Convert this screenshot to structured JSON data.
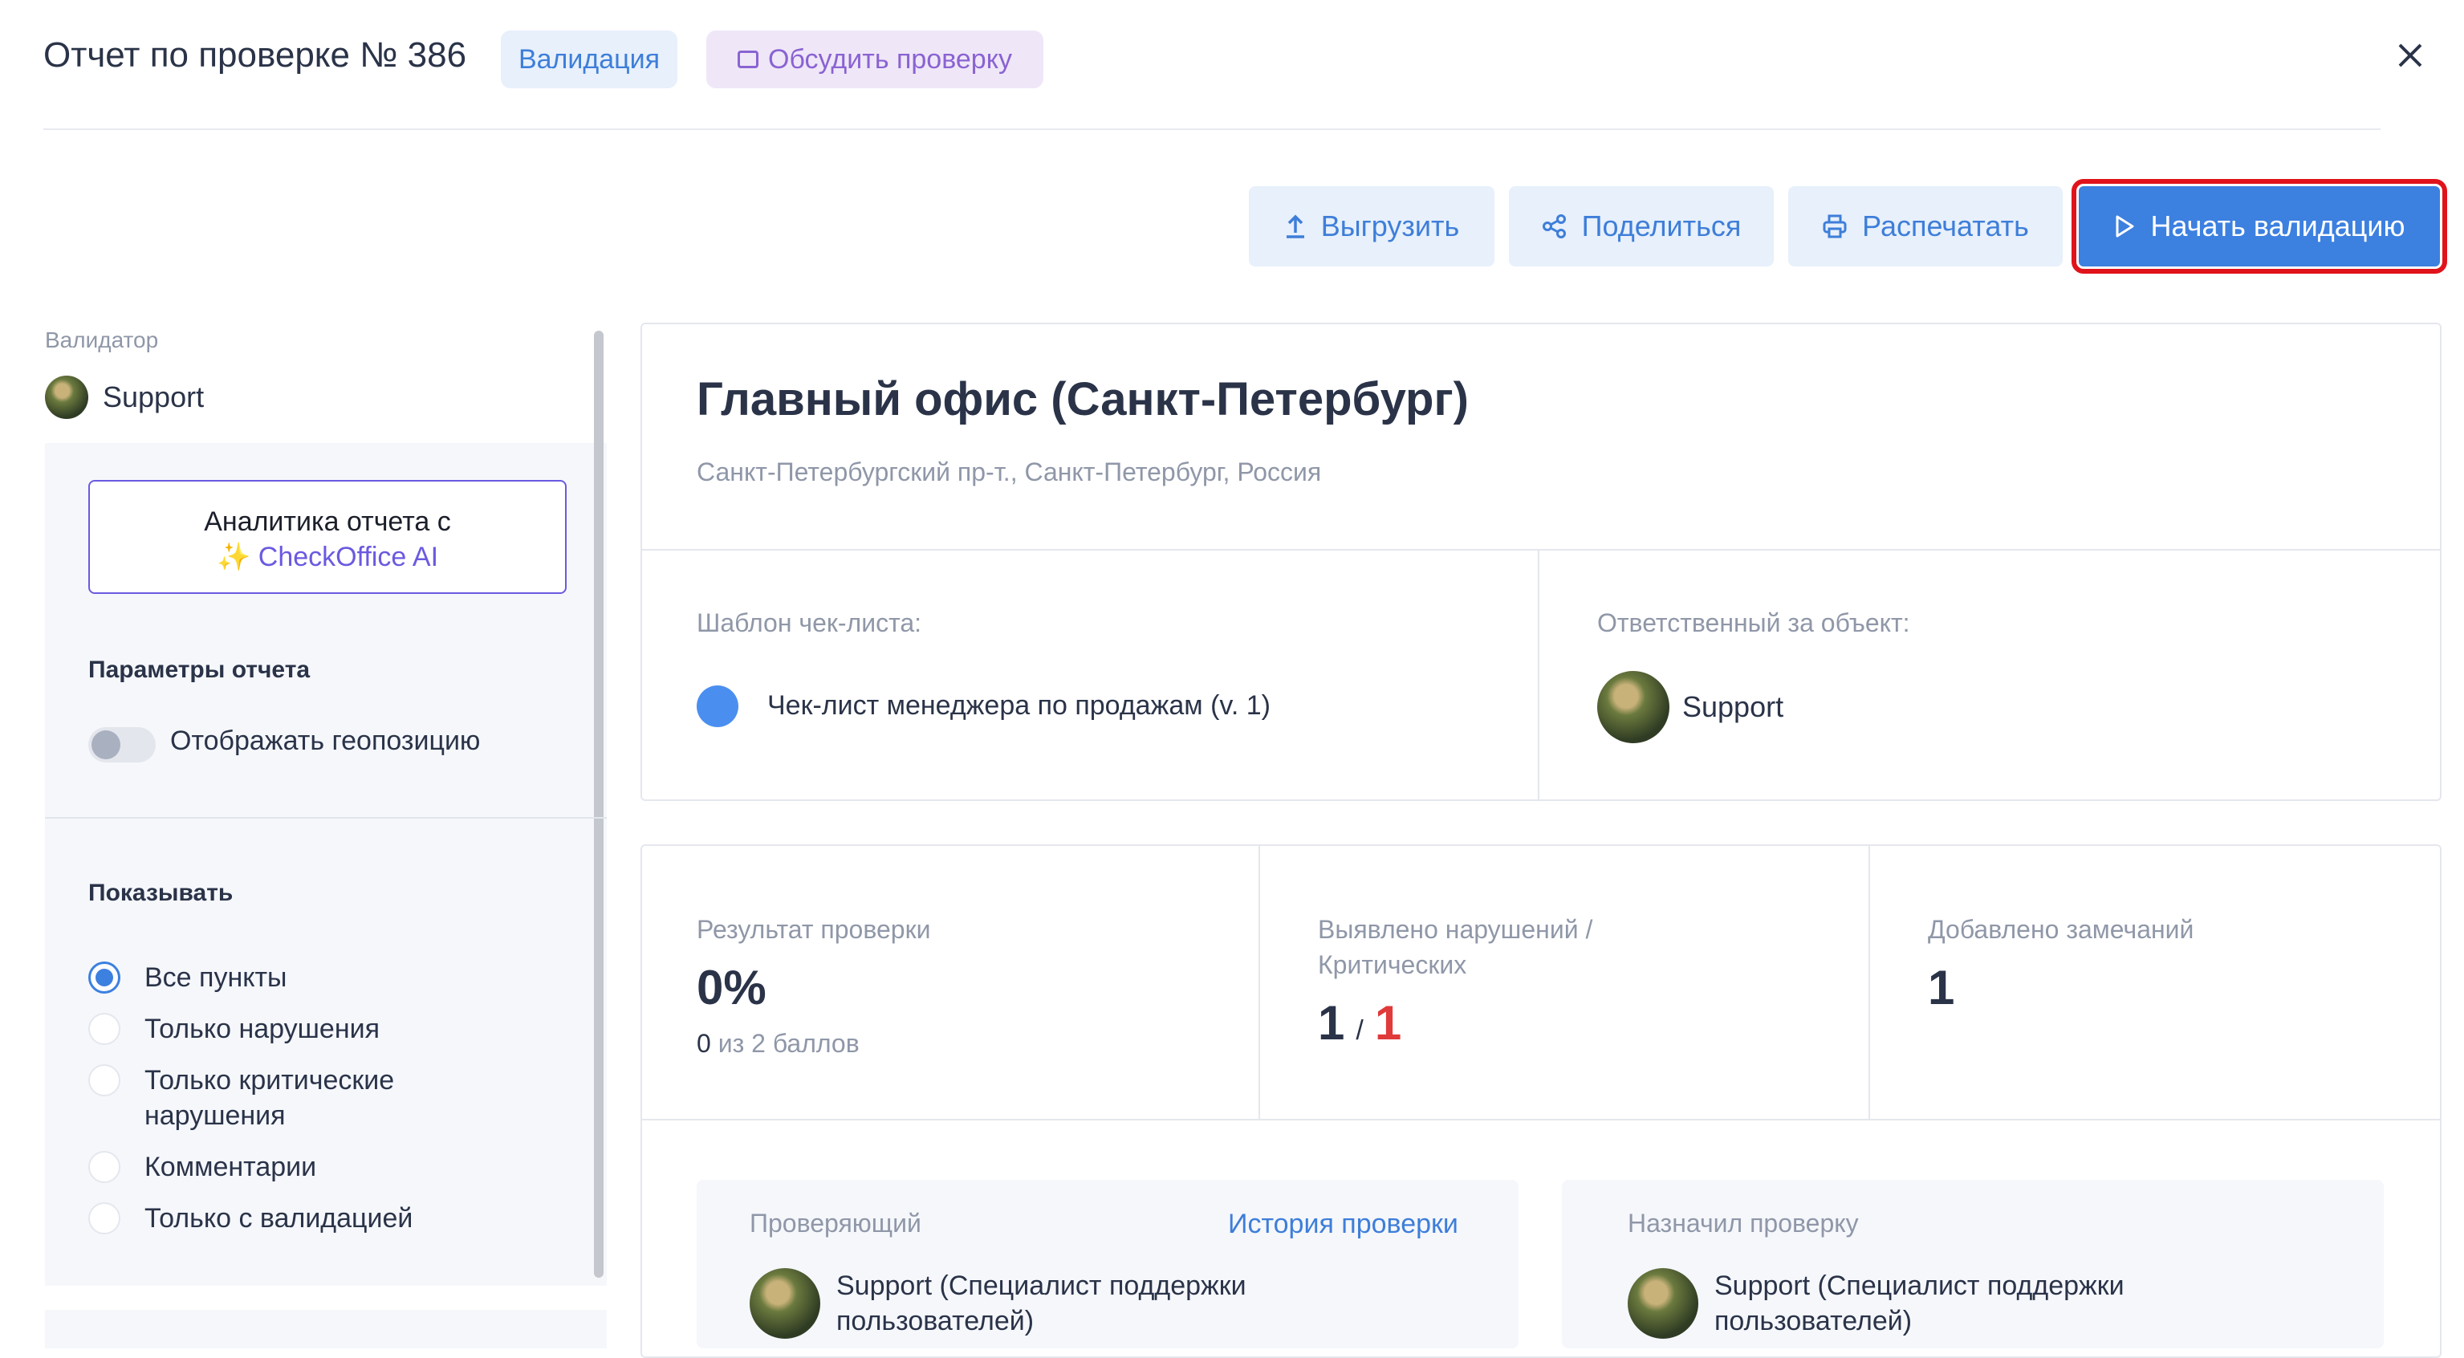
{
  "header": {
    "title": "Отчет по проверке № 386",
    "status_badge": "Валидация",
    "discuss_button": "Обсудить проверку"
  },
  "toolbar": {
    "export_label": "Выгрузить",
    "share_label": "Поделиться",
    "print_label": "Распечатать",
    "start_validation_label": "Начать валидацию"
  },
  "sidebar": {
    "validator_label": "Валидатор",
    "validator_name": "Support",
    "ai_card": {
      "line1": "Аналитика отчета с",
      "sparkle": "✨",
      "brand_prefix": "Check",
      "brand_suffix": "Office AI"
    },
    "params_title": "Параметры отчета",
    "geo_toggle_label": "Отображать геопозицию",
    "show_title": "Показывать",
    "filters": [
      {
        "label": "Все пункты",
        "selected": true
      },
      {
        "label": "Только нарушения",
        "selected": false
      },
      {
        "label": "Только критические нарушения",
        "selected": false
      },
      {
        "label": "Комментарии",
        "selected": false
      },
      {
        "label": "Только с валидацией",
        "selected": false
      }
    ]
  },
  "object": {
    "name": "Главный офис (Санкт-Петербург)",
    "address": "Санкт-Петербургский пр-т., Санкт-Петербург, Россия",
    "template_label": "Шаблон чек-листа:",
    "template_name": "Чек-лист менеджера по продажам (v. 1)",
    "responsible_label": "Ответственный за объект:",
    "responsible_name": "Support"
  },
  "stats": {
    "result_label": "Результат проверки",
    "result_value": "0%",
    "score_value": "0",
    "score_text": "из 2 баллов",
    "violations_label": "Выявлено нарушений / Критических",
    "violations_value": "1",
    "slash": "/",
    "critical_value": "1",
    "remarks_label": "Добавлено замечаний",
    "remarks_value": "1"
  },
  "inspector": {
    "label": "Проверяющий",
    "history_link": "История проверки",
    "name": "Support (Специалист поддержки пользователей)"
  },
  "assigner": {
    "label": "Назначил проверку",
    "name": "Support (Специалист поддержки пользователей)"
  },
  "colors": {
    "accent": "#3c80e0",
    "highlight_outline": "#e0131b",
    "critical": "#e03a3a",
    "ai_brand": "#6a5ae0"
  }
}
